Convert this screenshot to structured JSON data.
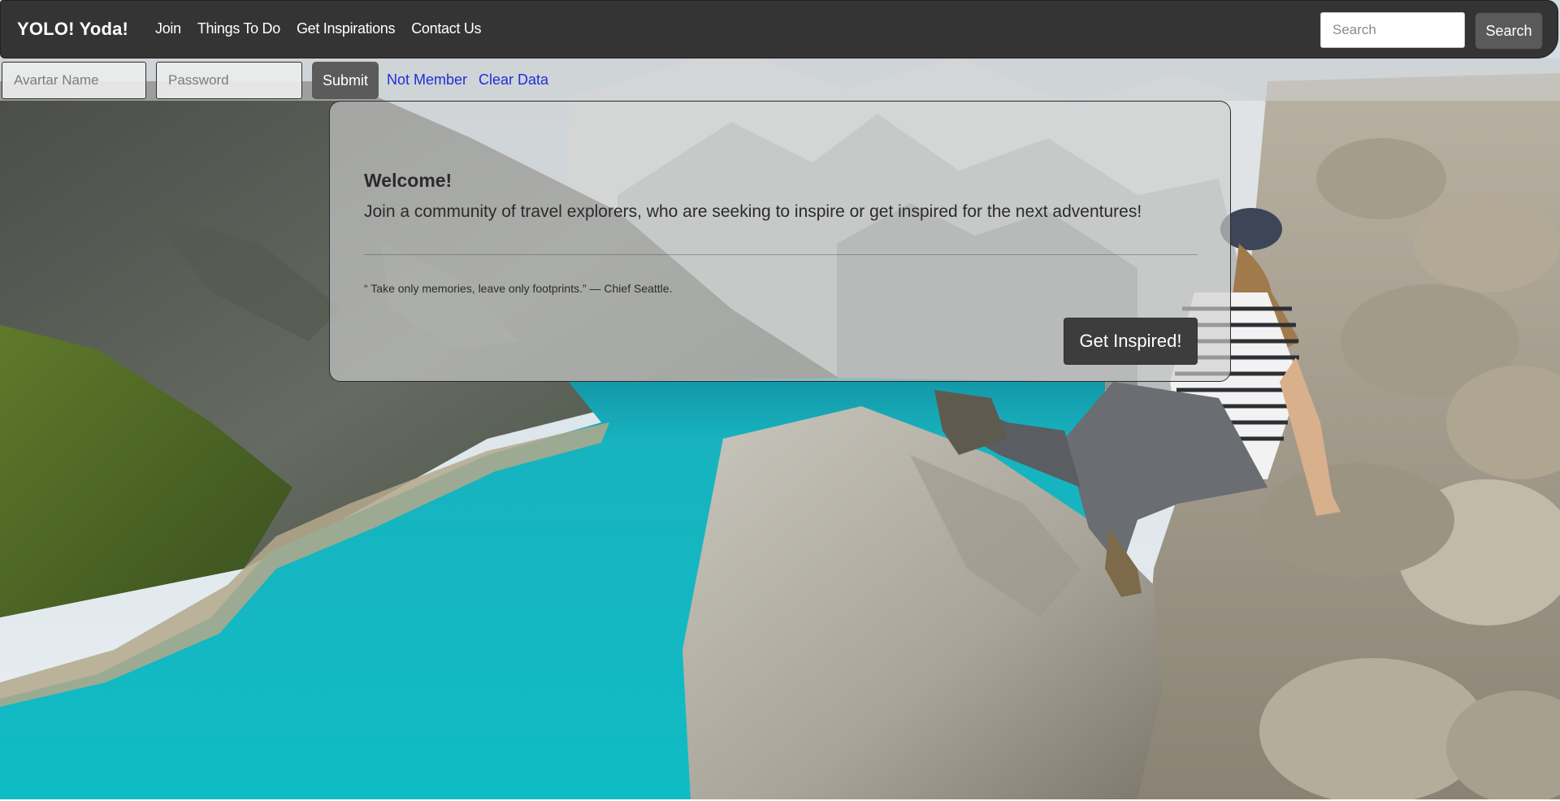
{
  "navbar": {
    "brand": "YOLO! Yoda!",
    "links": [
      "Join",
      "Things To Do",
      "Get Inspirations",
      "Contact Us"
    ],
    "search_placeholder": "Search",
    "search_button": "Search"
  },
  "login": {
    "name_placeholder": "Avartar Name",
    "password_placeholder": "Password",
    "submit_label": "Submit",
    "not_member_label": "Not Member",
    "clear_data_label": "Clear Data"
  },
  "card": {
    "title": "Welcome!",
    "lead": "Join a community of travel explorers, who are seeking to inspire or get inspired for the next adventures!",
    "quote": "“ Take only memories, leave only footprints.” — Chief Seattle.",
    "cta_label": "Get Inspired!"
  },
  "colors": {
    "navbar_bg": "#343434",
    "link_blue": "#1f2fd6",
    "lake": "#19b9c2"
  },
  "background": {
    "icon": "mountain-lake-photo-icon"
  }
}
